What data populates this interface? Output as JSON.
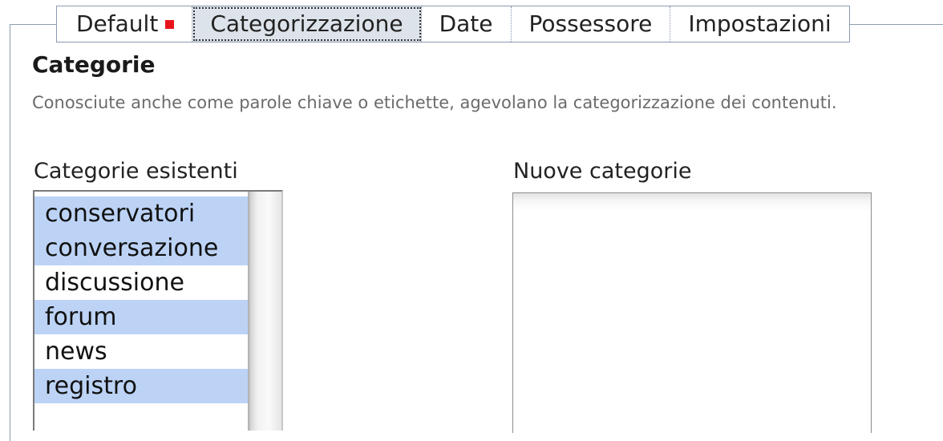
{
  "tabs": [
    {
      "label": "Default",
      "has_error_marker": true,
      "active": false
    },
    {
      "label": "Categorizzazione",
      "active": true
    },
    {
      "label": "Date",
      "active": false
    },
    {
      "label": "Possessore",
      "active": false
    },
    {
      "label": "Impostazioni",
      "active": false
    }
  ],
  "section": {
    "heading": "Categorie",
    "description": "Conosciute anche come parole chiave o etichette, agevolano la categorizzazione dei contenuti."
  },
  "existing": {
    "label": "Categorie esistenti",
    "items": [
      {
        "text": "conservatori",
        "selected": true
      },
      {
        "text": "conversazione",
        "selected": true
      },
      {
        "text": "discussione",
        "selected": false
      },
      {
        "text": "forum",
        "selected": true
      },
      {
        "text": "news",
        "selected": false
      },
      {
        "text": "registro",
        "selected": true
      }
    ]
  },
  "new_categories": {
    "label": "Nuove categorie",
    "value": ""
  },
  "colors": {
    "selection": "#bcd3f6",
    "error_marker": "#e8141c",
    "border": "#8a9bb0"
  }
}
